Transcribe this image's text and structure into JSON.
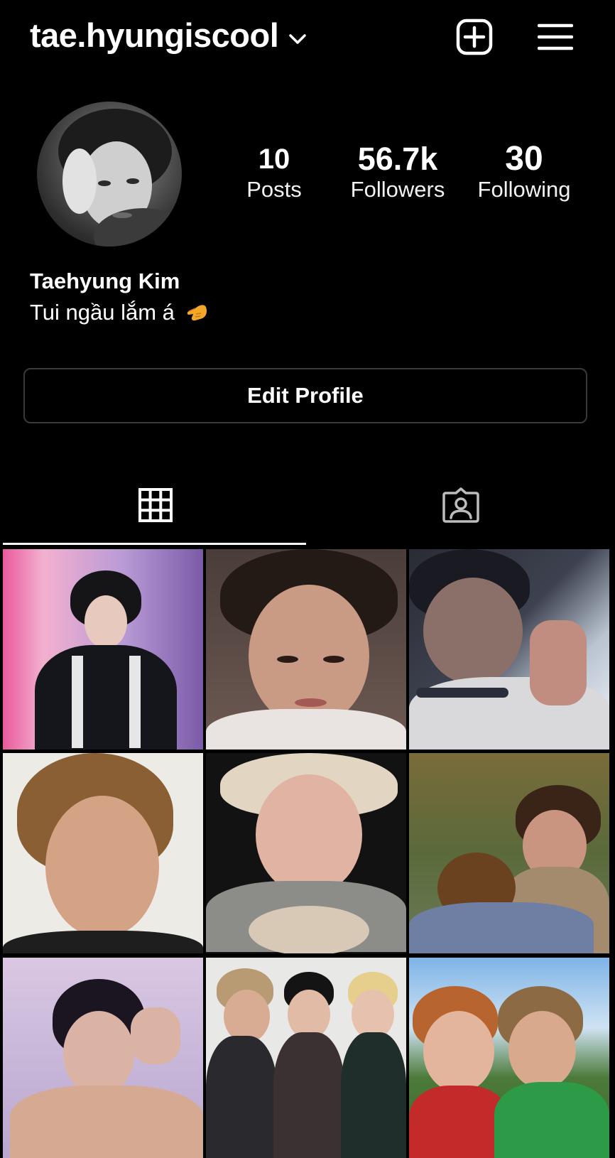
{
  "header": {
    "username": "tae.hyungiscool",
    "icons": [
      "chevron-down-icon",
      "new-post-icon",
      "menu-icon"
    ]
  },
  "profile": {
    "display_name": "Taehyung Kim",
    "bio": "Tui ngầu lắm á",
    "bio_emoji_icon": "pointing-hand-emoji-icon",
    "stats": {
      "posts": {
        "value": "10",
        "label": "Posts"
      },
      "followers": {
        "value": "56.7k",
        "label": "Followers"
      },
      "following": {
        "value": "30",
        "label": "Following"
      }
    }
  },
  "actions": {
    "edit_profile": "Edit Profile"
  },
  "tabs": [
    {
      "name": "grid",
      "icon": "grid-icon",
      "active": true
    },
    {
      "name": "tagged",
      "icon": "tagged-user-icon",
      "active": false
    }
  ],
  "posts_count_visible": 9,
  "colors": {
    "background": "#000000",
    "text": "#ffffff",
    "border": "#3a3a3a",
    "emoji": "#f4a62a"
  }
}
